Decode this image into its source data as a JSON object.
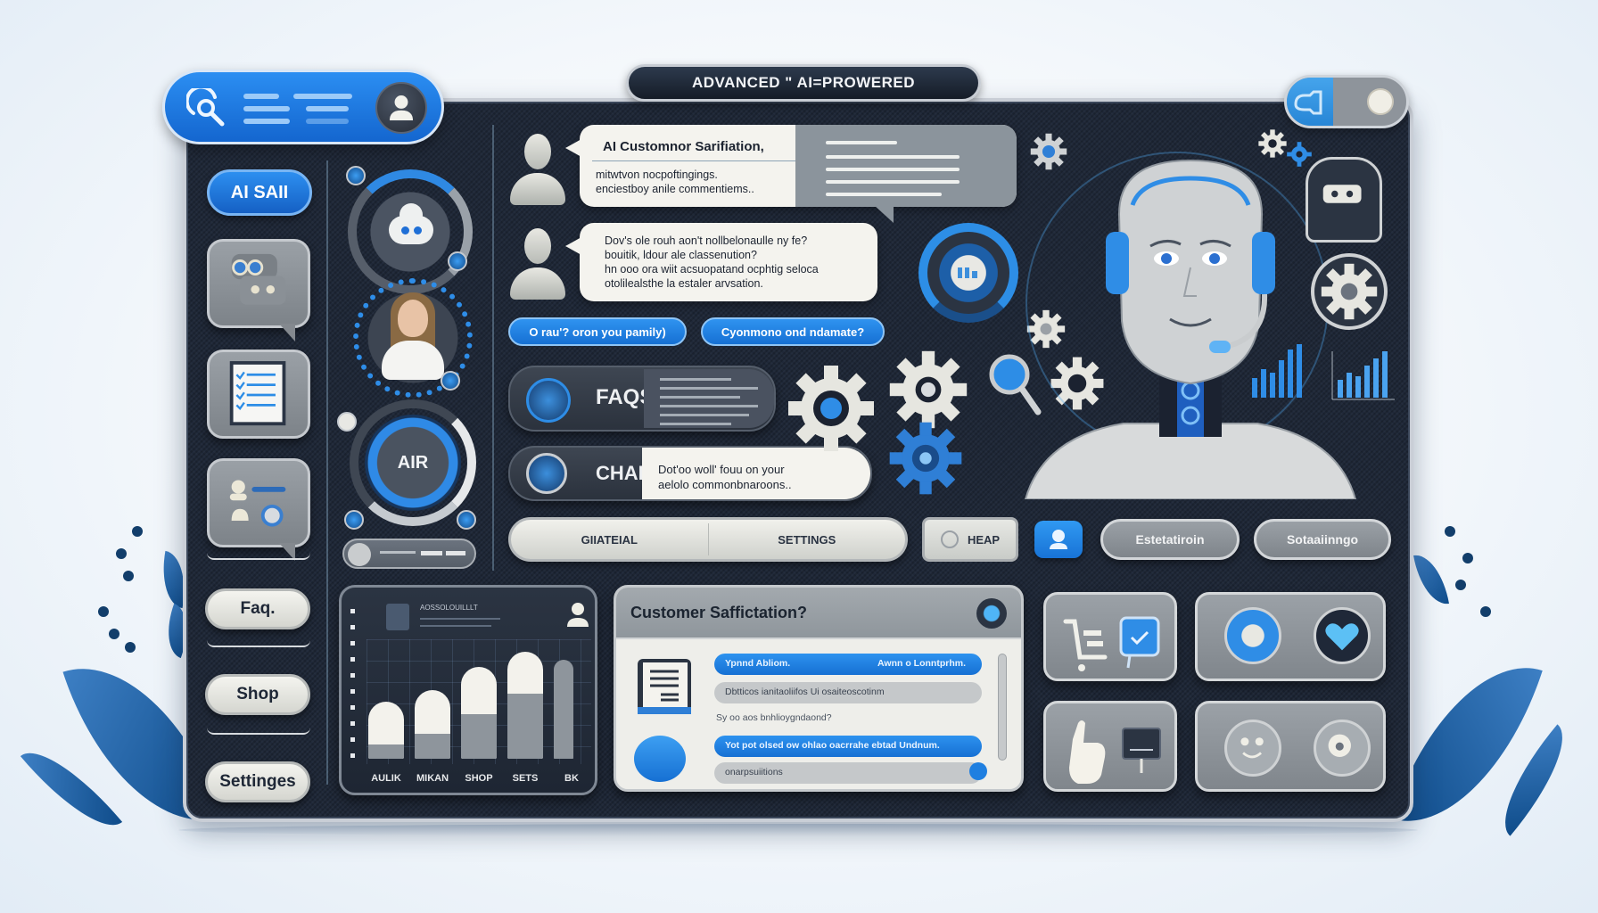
{
  "header": {
    "title": "ADVANCED \" AI=PROWERED",
    "search_icon": "search-icon",
    "menu_icon": "menu-lines-icon",
    "agent_avatar_icon": "support-agent-icon",
    "toggle_icon": "key-icon"
  },
  "sidebar": {
    "primary_button": "AI SAII",
    "tiles": [
      {
        "icon": "chat-bubbles-icon"
      },
      {
        "icon": "checklist-icon"
      },
      {
        "icon": "contacts-chat-icon"
      }
    ],
    "nav_buttons": [
      "Faq.",
      "Shop",
      "Settinges"
    ]
  },
  "widgets": {
    "chat_widget_icon": "cloud-chat-icon",
    "agent_photo": "agent-avatar",
    "air_dial_label": "AIR"
  },
  "chat": {
    "message_1": {
      "title": "AI Customnor Sarifiation,",
      "body": [
        "mitwtvon nocpoftingings.",
        "enciestboy anile commentiems.."
      ]
    },
    "message_2": {
      "body": [
        "Dov's ole rouh aon't nollbelonaulle ny fe?",
        "bouitik, ldour ale classenution?",
        "hn ooo ora wiit acsuopatand ocphtig seloca",
        "otolilealsthe la estaler arvsation."
      ]
    },
    "quick_replies": [
      "O rau'? oron you pamily)",
      "Cyonmono ond ndamate?"
    ]
  },
  "features": {
    "faqs": {
      "label": "FAQS"
    },
    "chap": {
      "label": "CHAP",
      "text": [
        "Dot'oo woll' fouu on your",
        "aelolo commonbnaroons.."
      ]
    }
  },
  "action_bar": {
    "segments": [
      "GIIATEIAL",
      "SETTINGS"
    ],
    "heap_button": "HEAP",
    "buttons": [
      "Estetatiroin",
      "Sotaaiinngo"
    ]
  },
  "bar_chart": {
    "header_text": "AOSSOLOUILLLT",
    "chart_data": {
      "type": "bar",
      "title": "",
      "categories": [
        "AULIK",
        "MIKAN",
        "SHOP",
        "SETS",
        "BK"
      ],
      "values": [
        30,
        36,
        48,
        56,
        52
      ],
      "ylim": [
        0,
        70
      ],
      "xlabel": "",
      "ylabel": ""
    }
  },
  "satisfaction": {
    "title": "Customer Saffictation?",
    "lines": [
      {
        "style": "blue",
        "left": "Ypnnd Abliom.",
        "right": "Awnn o Lonntprhm."
      },
      {
        "style": "gray",
        "text": "Dbtticos ianitaoliifos Ui osaiteoscotinm"
      },
      {
        "style": "plain",
        "text": "Sy oo aos bnhlioygndaond?"
      },
      {
        "style": "blue",
        "text": "Yot pot olsed ow ohlao oacrrahe ebtad Undnum."
      },
      {
        "style": "gray",
        "text": "onarpsuiitions"
      }
    ]
  },
  "tiles": [
    {
      "icons": [
        "shopping-cart-icon",
        "check-message-icon"
      ]
    },
    {
      "icons": [
        "printer-icon",
        "heart-icon"
      ]
    },
    {
      "icons": [
        "pointing-hand-icon",
        "signboard-icon"
      ]
    },
    {
      "icons": [
        "smiley-icon",
        "brain-icon"
      ]
    }
  ],
  "colors": {
    "accent": "#1f7fe0",
    "panel": "#1f2838",
    "light": "#f4f3ee"
  }
}
